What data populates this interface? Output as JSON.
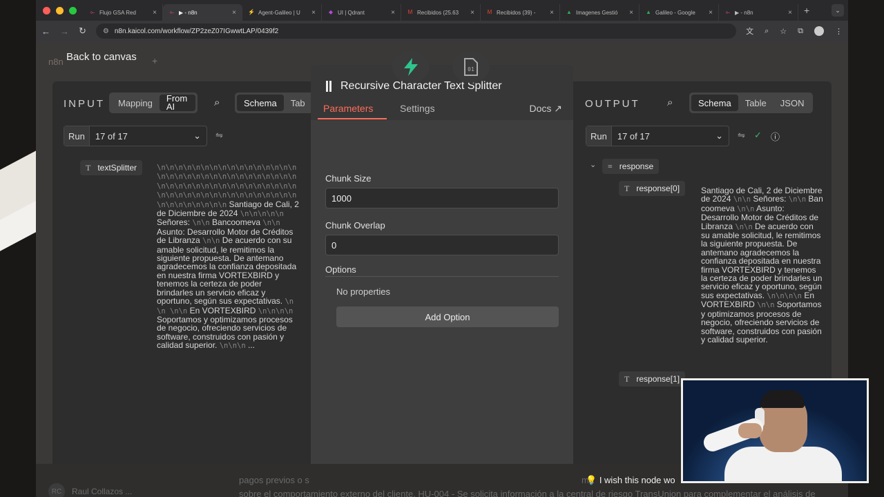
{
  "browser": {
    "tabs": [
      {
        "title": "Flujo GSA Red",
        "favicon": "n8n-icon",
        "active": false
      },
      {
        "title": "▶ - n8n",
        "favicon": "n8n-icon",
        "active": true
      },
      {
        "title": "Agent-Galileo | U",
        "favicon": "bolt-icon",
        "active": false
      },
      {
        "title": "UI | Qdrant",
        "favicon": "qdrant-icon",
        "active": false
      },
      {
        "title": "Recibidos (25.63",
        "favicon": "gmail-icon",
        "active": false
      },
      {
        "title": "Recibidos (39) -",
        "favicon": "gmail-icon",
        "active": false
      },
      {
        "title": "Imagenes Gestió",
        "favicon": "drive-icon",
        "active": false
      },
      {
        "title": "Galileo - Google",
        "favicon": "drive-icon",
        "active": false
      },
      {
        "title": "▶ - n8n",
        "favicon": "n8n-icon",
        "active": false
      }
    ],
    "url": "n8n.kaicol.com/workflow/ZP2zeZ07IGwwtLAP/0439f2"
  },
  "header": {
    "logo_text": "n8n",
    "back_label": "Back to canvas"
  },
  "input_panel": {
    "title": "INPUT",
    "mode_tabs": [
      "Mapping",
      "From AI"
    ],
    "view_tabs": [
      "Schema",
      "Tab"
    ],
    "run_label": "Run",
    "run_value": "17 of 17",
    "key": "textSplitter",
    "newlines": "\\n\\n\\n\\n\\n\\n\\n\\n\\n\\n\\n\\n\\n\\n\\n\\n\\n\\n\\n\\n\\n\\n\\n\\n\\n\\n\\n\\n\\n\\n\\n\\n\\n\\n\\n\\n\\n\\n\\n\\n\\n\\n\\n\\n\\n\\n\\n\\n\\n\\n\\n\\n\\n\\n\\n\\n\\n\\n\\n\\n\\n\\n\\n\\n\\n\\n\\n\\n\\n\\n\\n\\n",
    "value_parts": [
      "Santiago de Cali, 2 de Diciembre de 2024",
      "\\n\\n\\n\\n\\n",
      "Señores:",
      "\\n\\n",
      "Bancoomeva",
      "\\n\\n",
      "Asunto: Desarrollo Motor de Créditos de Libranza",
      "\\n\\n",
      "De acuerdo con su amable solicitud, le remitimos la siguiente propuesta. De antemano agradecemos la confianza depositada en nuestra firma VORTEXBIRD y tenemos la certeza de poder brindarles un servicio eficaz y oportuno, según sus expectativas.",
      "\\n\\n \\n\\n",
      "En VORTEXBIRD",
      "\\n\\n\\n\\n",
      "Soportamos y optimizamos procesos de negocio, ofreciendo servicios de software, construidos con pasión y calidad superior.",
      "\\n\\n\\n",
      "..."
    ]
  },
  "modal": {
    "title": "Recursive Character Text Splitter",
    "tabs": [
      "Parameters",
      "Settings"
    ],
    "docs_label": "Docs",
    "chunk_size_label": "Chunk Size",
    "chunk_size_value": "1000",
    "chunk_overlap_label": "Chunk Overlap",
    "chunk_overlap_value": "0",
    "options_label": "Options",
    "no_properties": "No properties",
    "add_option": "Add Option"
  },
  "output_panel": {
    "title": "OUTPUT",
    "view_tabs": [
      "Schema",
      "Table",
      "JSON"
    ],
    "run_label": "Run",
    "run_value": "17 of 17",
    "root_key": "response",
    "item0_key": "response[0]",
    "item1_key": "response[1]",
    "value_parts": [
      "Santiago de Cali, 2 de Diciembre de 2024",
      "\\n\\n",
      "Señores:",
      "\\n\\n",
      "Ban coomeva",
      "\\n\\n",
      "Asunto: Desarrollo Motor de Créditos de Libranza",
      "\\n\\n",
      "De acuerdo con su amable solicitud, le remitimos la siguiente propuesta. De antemano agradecemos la confianza depositada en nuestra firma VORTEXBIRD y tenemos la certeza de poder brindarles un servicio eficaz y oportuno, según sus expectativas.",
      "\\n\\n\\n\\n",
      "En VORTEXBIRD",
      "\\n\\n",
      "Soportamos y optimizamos procesos de negocio, ofreciendo servicios de software, construidos con pasión y calidad superior."
    ]
  },
  "bottom": {
    "line1": "pagos previos o s",
    "line1_right": "ma",
    "line2": "sobre el comportamiento externo del cliente.    HU-004 - Se solicita información a la central de riesgo TransUnion para complementar el análisis de",
    "user_initials": "RC",
    "user_name": "Raul Collazos ..."
  },
  "overlay": {
    "caption": "I wish this node wo"
  },
  "colors": {
    "accent": "#ff6d5a",
    "app_bg": "#3a3937",
    "panel_bg": "#2d2d2d",
    "modal_bg": "#3e3e3e"
  }
}
